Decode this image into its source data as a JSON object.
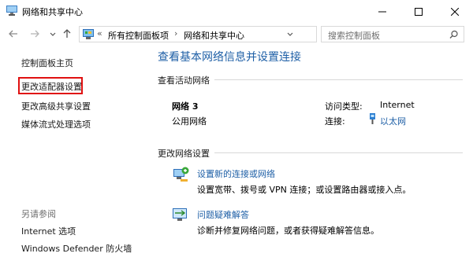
{
  "window": {
    "title": "网络和共享中心"
  },
  "address_bar": {
    "overflow": "«",
    "crumbs": [
      "所有控制面板项",
      "网络和共享中心"
    ],
    "search_placeholder": "搜索控制面板"
  },
  "sidebar": {
    "home": "控制面板主页",
    "change_adapter": "更改适配器设置",
    "advanced_sharing": "更改高级共享设置",
    "media_streaming": "媒体流式处理选项",
    "see_also_title": "另请参阅",
    "internet_options": "Internet 选项",
    "firewall": "Windows Defender 防火墙"
  },
  "main": {
    "title": "查看基本网络信息并设置连接",
    "active_networks_header": "查看活动网络",
    "network_name": "网络 3",
    "network_type": "公用网络",
    "access_type_label": "访问类型:",
    "access_type_value": "Internet",
    "connections_label": "连接:",
    "connections_value": "以太网",
    "change_settings_header": "更改网络设置",
    "new_connection_link": "设置新的连接或网络",
    "new_connection_desc": "设置宽带、拨号或 VPN 连接；或设置路由器或接入点。",
    "troubleshoot_link": "问题疑难解答",
    "troubleshoot_desc": "诊断并修复网络问题，或者获得疑难解答信息。"
  },
  "colors": {
    "link_blue": "#1e5fa6",
    "highlight_red": "#e01010"
  }
}
